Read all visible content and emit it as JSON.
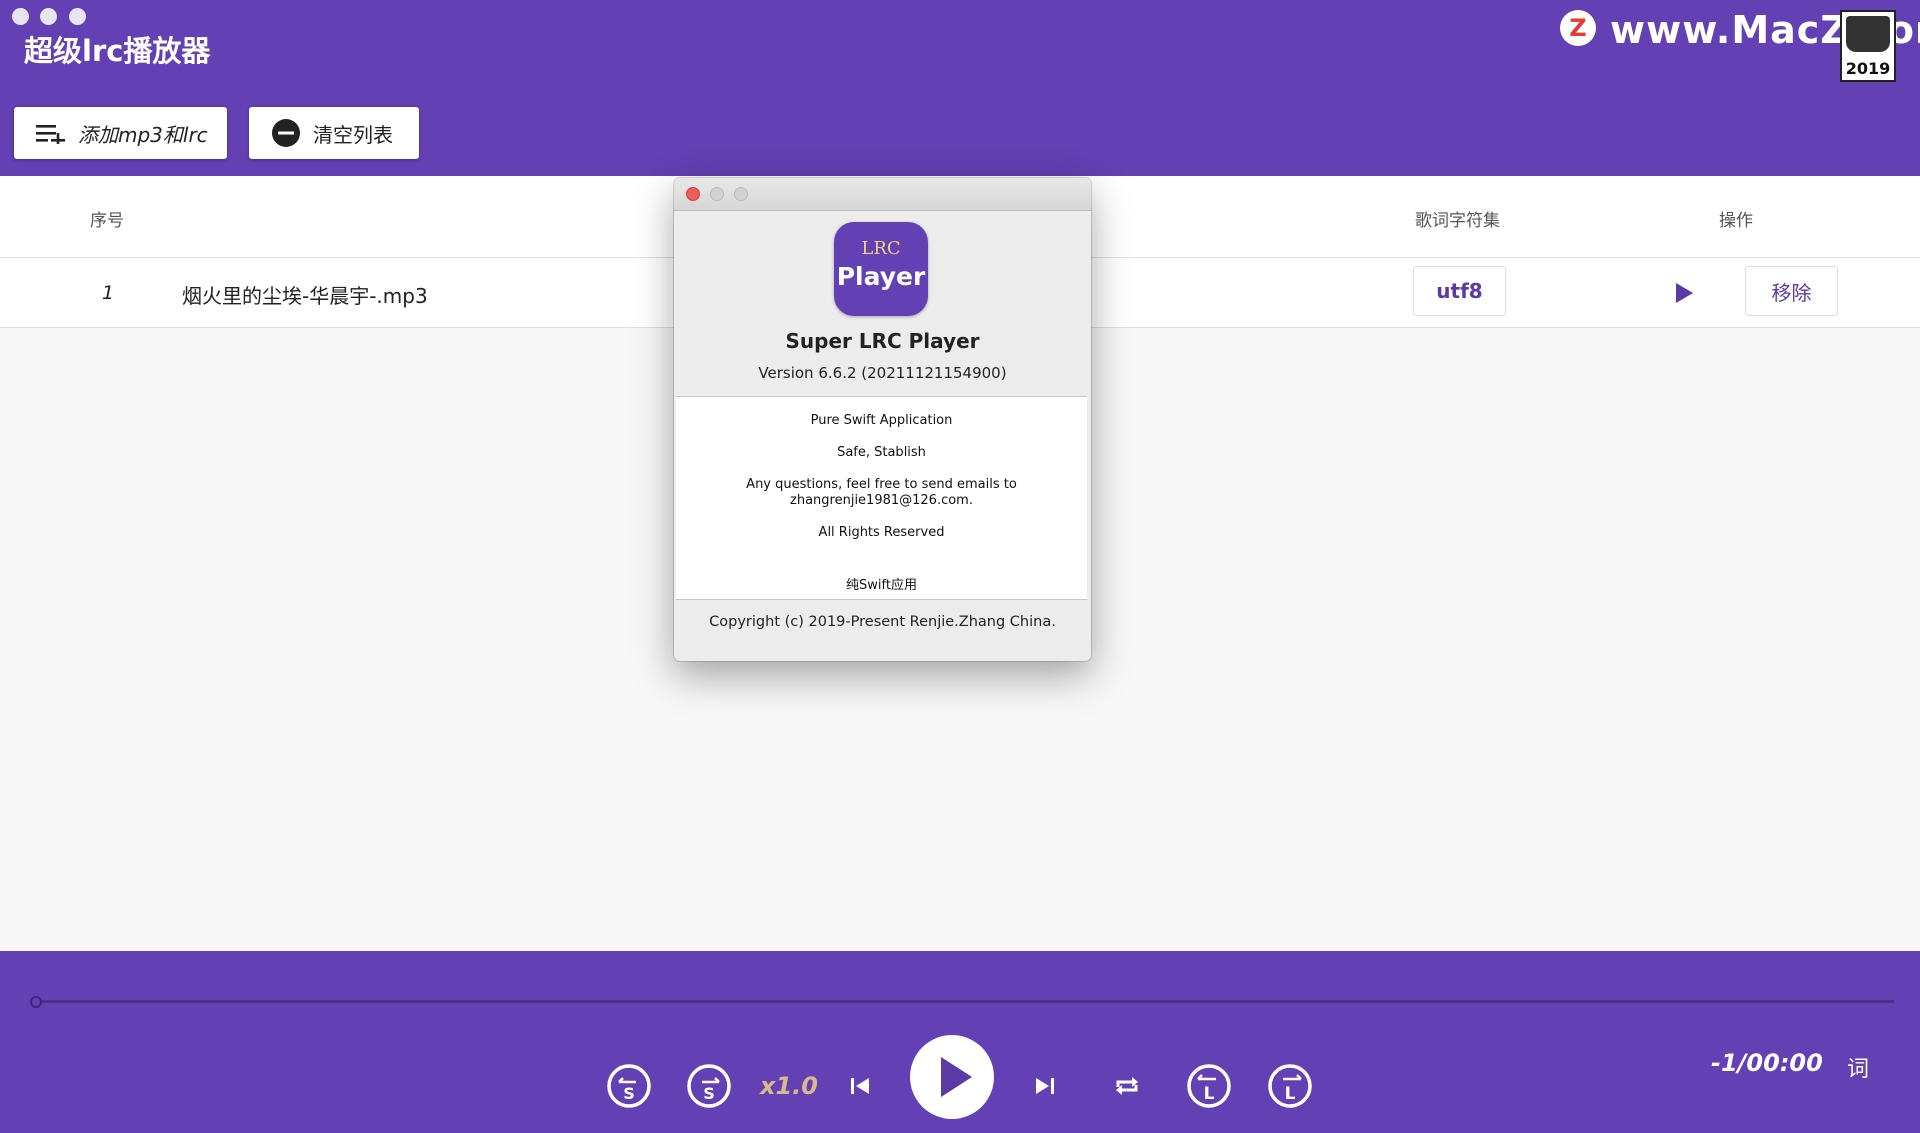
{
  "app": {
    "title": "超级lrc播放器"
  },
  "watermark": {
    "logo_letter": "Z",
    "site": "www.MacZ.com",
    "badge_year": "2019"
  },
  "toolbar": {
    "add_label": "添加mp3和lrc",
    "clear_label": "清空列表"
  },
  "table": {
    "headers": {
      "index": "序号",
      "charset": "歌词字符集",
      "actions": "操作"
    },
    "rows": [
      {
        "index": "1",
        "name": "烟火里的尘埃-华晨宇-.mp3",
        "charset": "utf8",
        "remove_label": "移除"
      }
    ]
  },
  "player": {
    "speed": "x1.0",
    "time": "-1/00:00",
    "lyrics_label": "词",
    "progress": 0,
    "button_letters": {
      "seek": "S",
      "loop": "L"
    }
  },
  "about": {
    "icon_line1": "LRC",
    "icon_line2": "Player",
    "app_name": "Super LRC Player",
    "version": "Version 6.6.2 (20211121154900)",
    "credits": [
      "Pure Swift Application",
      "Safe, Stablish",
      "Any questions, feel free to send emails to",
      "zhangrenjie1981@126.com.",
      "All Rights Reserved",
      "纯Swift应用"
    ],
    "copyright": "Copyright (c) 2019-Present Renjie.Zhang China."
  },
  "colors": {
    "brand": "#6340b3",
    "accent_text": "#5b3aa8",
    "speed_text": "#d8b98f",
    "close_red": "#ec5f57"
  }
}
